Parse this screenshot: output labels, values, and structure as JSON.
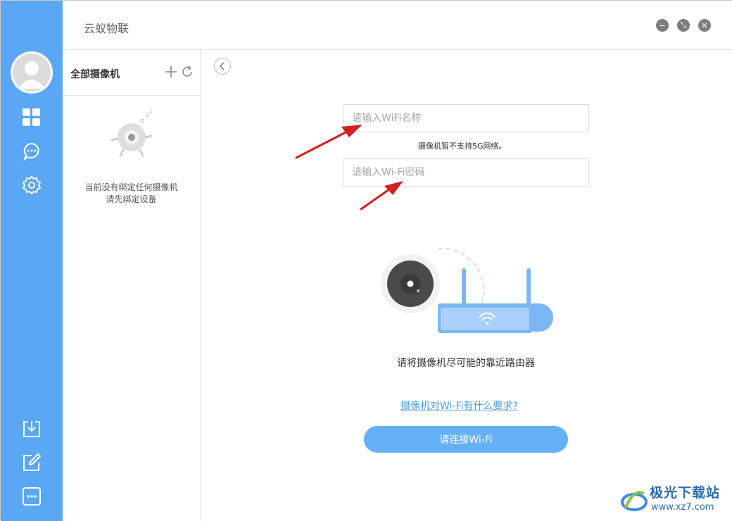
{
  "app": {
    "title": "云蚁物联"
  },
  "window_controls": {
    "minimize_glyph": "−",
    "restore_glyph": "⤡",
    "close_glyph": "✕"
  },
  "nav": {
    "items": [
      {
        "icon": "grid-icon"
      },
      {
        "icon": "chat-bubble-icon"
      },
      {
        "icon": "gear-icon"
      },
      {
        "icon": "download-icon"
      },
      {
        "icon": "edit-icon"
      },
      {
        "icon": "more-icon"
      }
    ]
  },
  "device_panel": {
    "title": "全部摄像机",
    "empty_line1": "当前没有绑定任何摄像机",
    "empty_line2": "请先绑定设备"
  },
  "wifi_form": {
    "ssid_placeholder": "请输入WiFi名称",
    "hint": "摄像机暂不支持5G网络。",
    "password_placeholder": "请输入Wi-Fi密码",
    "tip": "请将摄像机尽可能的靠近路由器",
    "requirements_link": "摄像机对Wi-Fi有什么要求?",
    "connect_button": "请连接Wi-Fi"
  },
  "watermark": {
    "name": "极光下载站",
    "url": "www.xz7.com"
  },
  "colors": {
    "rail": "#5aa7f5",
    "primary_button": "#66b0f8",
    "link": "#4a9fe8",
    "annotation_arrow": "#d42020"
  }
}
